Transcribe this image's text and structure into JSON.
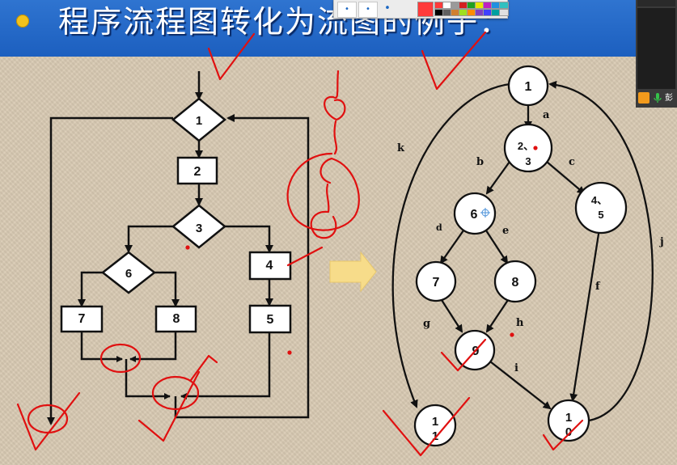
{
  "title": "程序流程图转化为流图的例子：",
  "flowchart": {
    "n1": "1",
    "n2": "2",
    "n3": "3",
    "n4": "4",
    "n5": "5",
    "n6": "6",
    "n7": "7",
    "n8": "8"
  },
  "flowgraph": {
    "nodes": {
      "g1": "1",
      "g23a": "2、",
      "g23b": "3",
      "g45a": "4、",
      "g45b": "5",
      "g6": "6",
      "g7": "7",
      "g8": "8",
      "g9": "9",
      "g11a": "1",
      "g11b": "1",
      "g10a": "1",
      "g10b": "0"
    },
    "edges": {
      "a": "a",
      "b": "b",
      "c": "c",
      "d": "d",
      "e": "e",
      "f": "f",
      "g": "g",
      "h": "h",
      "i": "i",
      "j": "j",
      "k": "k"
    }
  },
  "colors": {
    "title_bg": "#1c5fbf",
    "bullet": "#f3c21b",
    "arrow": "#f7dc8a",
    "annotation": "#e01010"
  },
  "palette_colors": [
    "#ff3b3b",
    "#ffffff",
    "#9a9a9a",
    "#d32020",
    "#20a020",
    "#e8e800",
    "#c020c0",
    "#2090e0",
    "#30c0c0",
    "#000000",
    "#606060",
    "#d08030",
    "#a0e020",
    "#ff8c00",
    "#8040c0",
    "#4040ff",
    "#00a0a0",
    "#e0e0e0"
  ]
}
